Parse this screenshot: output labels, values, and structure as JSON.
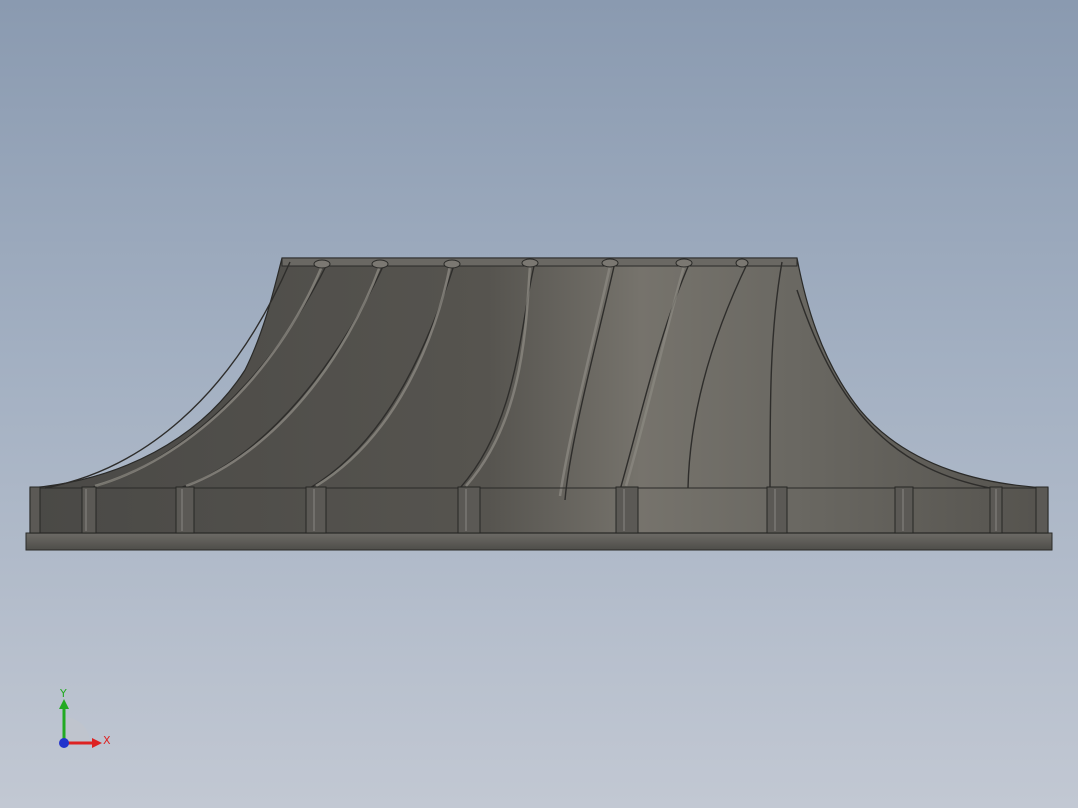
{
  "triad": {
    "y_label": "Y",
    "x_label": "X",
    "colors": {
      "y_axis": "#22aa22",
      "x_axis": "#dd2222",
      "z_axis": "#2233cc"
    }
  },
  "viewport": {
    "background_top": "#8a9ab0",
    "background_bottom": "#c2c8d3",
    "model_color": "#5e5c58"
  }
}
